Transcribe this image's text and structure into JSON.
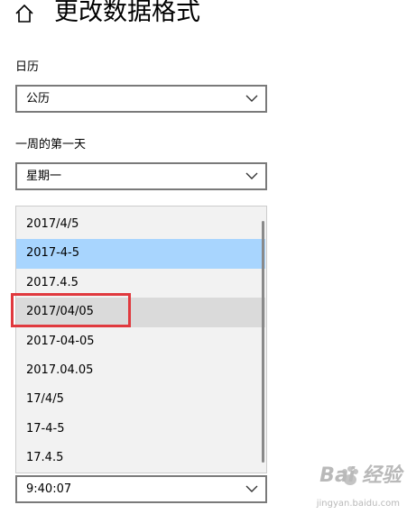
{
  "header": {
    "home_icon": "home-icon",
    "title": "更改数据格式"
  },
  "calendar": {
    "label": "日历",
    "value": "公历"
  },
  "first_day": {
    "label": "一周的第一天",
    "value": "星期一"
  },
  "short_date_dropdown": {
    "options": [
      "2017/4/5",
      "2017-4-5",
      "2017.4.5",
      "2017/04/05",
      "2017-04-05",
      "2017.04.05",
      "17/4/5",
      "17-4-5",
      "17.4.5"
    ],
    "selected": "2017-4-5",
    "hovered": "2017/04/05"
  },
  "long_time": {
    "value": "9:40:07"
  },
  "watermark": {
    "brand": "Bai 经验",
    "url": "jingyan.baidu.com"
  },
  "colors": {
    "selected_bg": "#a8d5fe",
    "hover_bg": "#dadada",
    "highlight_border": "#e0393e",
    "combo_border": "#7a7a7a"
  }
}
